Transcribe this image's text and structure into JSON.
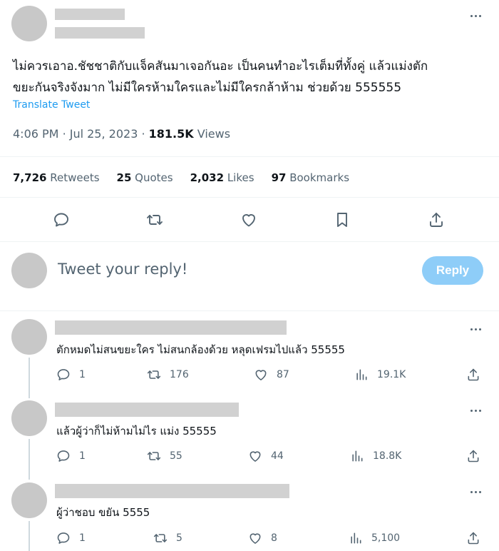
{
  "tweet": {
    "text_line1": "ไม่ควรเอาอ.ชัชชาติกับแจ็คสันมาเจอกันอะ เป็นคนทำอะไรเต็มที่ทั้งคู่ แล้วแม่งตัก",
    "text_line2": "ขยะกันจริงจังมาก ไม่มีใครห้ามใครและไม่มีใครกล้าห้าม ช่วยด้วย 555555",
    "translate_label": "Translate Tweet",
    "time": "4:06 PM",
    "date": "Jul 25, 2023",
    "views_count": "181.5K",
    "views_label": "Views",
    "stats": {
      "retweets": {
        "count": "7,726",
        "label": "Retweets"
      },
      "quotes": {
        "count": "25",
        "label": "Quotes"
      },
      "likes": {
        "count": "2,032",
        "label": "Likes"
      },
      "bookmarks": {
        "count": "97",
        "label": "Bookmarks"
      }
    },
    "actions": [
      "reply-icon",
      "retweet-icon",
      "like-icon",
      "bookmark-icon",
      "share-icon"
    ]
  },
  "composer": {
    "placeholder": "Tweet your reply!",
    "reply_label": "Reply"
  },
  "colors": {
    "accent": "#1d9bf0",
    "reply_button_disabled": "#8ecdf8",
    "muted_text": "#536471",
    "redaction": "#d1d1d1"
  },
  "comments": [
    {
      "text": "ตักหมดไม่สนขยะใคร ไม่สนกล้องด้วย หลุดเฟรมไปแล้ว 55555",
      "replies": "1",
      "retweets": "176",
      "likes": "87",
      "views": "19.1K"
    },
    {
      "text": "แล้วผู้ว่าก็ไม่ห้ามไม่ไร แม่ง 55555",
      "replies": "1",
      "retweets": "55",
      "likes": "44",
      "views": "18.8K"
    },
    {
      "text": "ผู้ว่าชอบ ขยัน 5555",
      "replies": "1",
      "retweets": "5",
      "likes": "8",
      "views": "5,100"
    }
  ]
}
